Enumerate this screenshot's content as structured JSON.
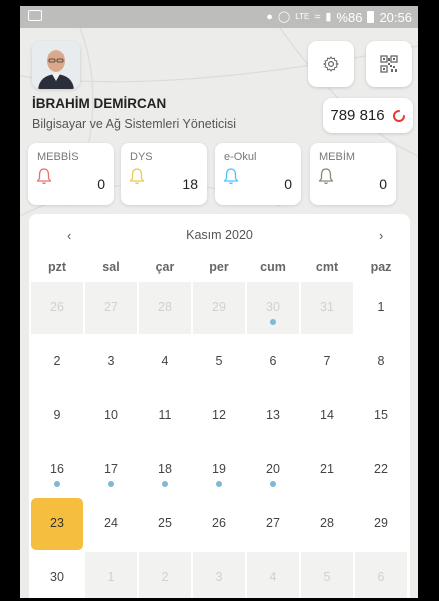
{
  "status_bar": {
    "battery": "%86",
    "time": "20:56",
    "network": "LTE"
  },
  "profile": {
    "name": "İBRAHİM DEMİRCAN",
    "role": "Bilgisayar ve Ağ Sistemleri Yöneticisi",
    "score": "789 816"
  },
  "notifications": [
    {
      "label": "MEBBİS",
      "count": "0",
      "bell_color": "#e57373"
    },
    {
      "label": "DYS",
      "count": "18",
      "bell_color": "#e8cc52"
    },
    {
      "label": "e-Okul",
      "count": "0",
      "bell_color": "#4fc3f7"
    },
    {
      "label": "MEBİM",
      "count": "0",
      "bell_color": "#8a8a73"
    }
  ],
  "calendar": {
    "title": "Kasım 2020",
    "prev": "‹",
    "next": "›",
    "weekdays": [
      "pzt",
      "sal",
      "çar",
      "per",
      "cum",
      "cmt",
      "paz"
    ],
    "weeks": [
      [
        {
          "d": "26",
          "other": true
        },
        {
          "d": "27",
          "other": true
        },
        {
          "d": "28",
          "other": true
        },
        {
          "d": "29",
          "other": true
        },
        {
          "d": "30",
          "other": true,
          "dot": true
        },
        {
          "d": "31",
          "other": true
        },
        {
          "d": "1"
        }
      ],
      [
        {
          "d": "2"
        },
        {
          "d": "3"
        },
        {
          "d": "4"
        },
        {
          "d": "5"
        },
        {
          "d": "6"
        },
        {
          "d": "7"
        },
        {
          "d": "8"
        }
      ],
      [
        {
          "d": "9"
        },
        {
          "d": "10"
        },
        {
          "d": "11"
        },
        {
          "d": "12"
        },
        {
          "d": "13"
        },
        {
          "d": "14"
        },
        {
          "d": "15"
        }
      ],
      [
        {
          "d": "16",
          "dot": true
        },
        {
          "d": "17",
          "dot": true
        },
        {
          "d": "18",
          "dot": true
        },
        {
          "d": "19",
          "dot": true
        },
        {
          "d": "20",
          "dot": true
        },
        {
          "d": "21"
        },
        {
          "d": "22"
        }
      ],
      [
        {
          "d": "23",
          "today": true
        },
        {
          "d": "24"
        },
        {
          "d": "25"
        },
        {
          "d": "26"
        },
        {
          "d": "27"
        },
        {
          "d": "28"
        },
        {
          "d": "29"
        }
      ],
      [
        {
          "d": "30"
        },
        {
          "d": "1",
          "other": true
        },
        {
          "d": "2",
          "other": true
        },
        {
          "d": "3",
          "other": true
        },
        {
          "d": "4",
          "other": true
        },
        {
          "d": "5",
          "other": true
        },
        {
          "d": "6",
          "other": true
        }
      ]
    ],
    "dot_color": "#7fb8d6"
  },
  "colors": {
    "accent_today": "#f6be3e",
    "spinner": "#e53935"
  },
  "icons": {
    "settings": "gear-icon",
    "qr": "qr-code-icon",
    "bell": "bell-icon"
  }
}
